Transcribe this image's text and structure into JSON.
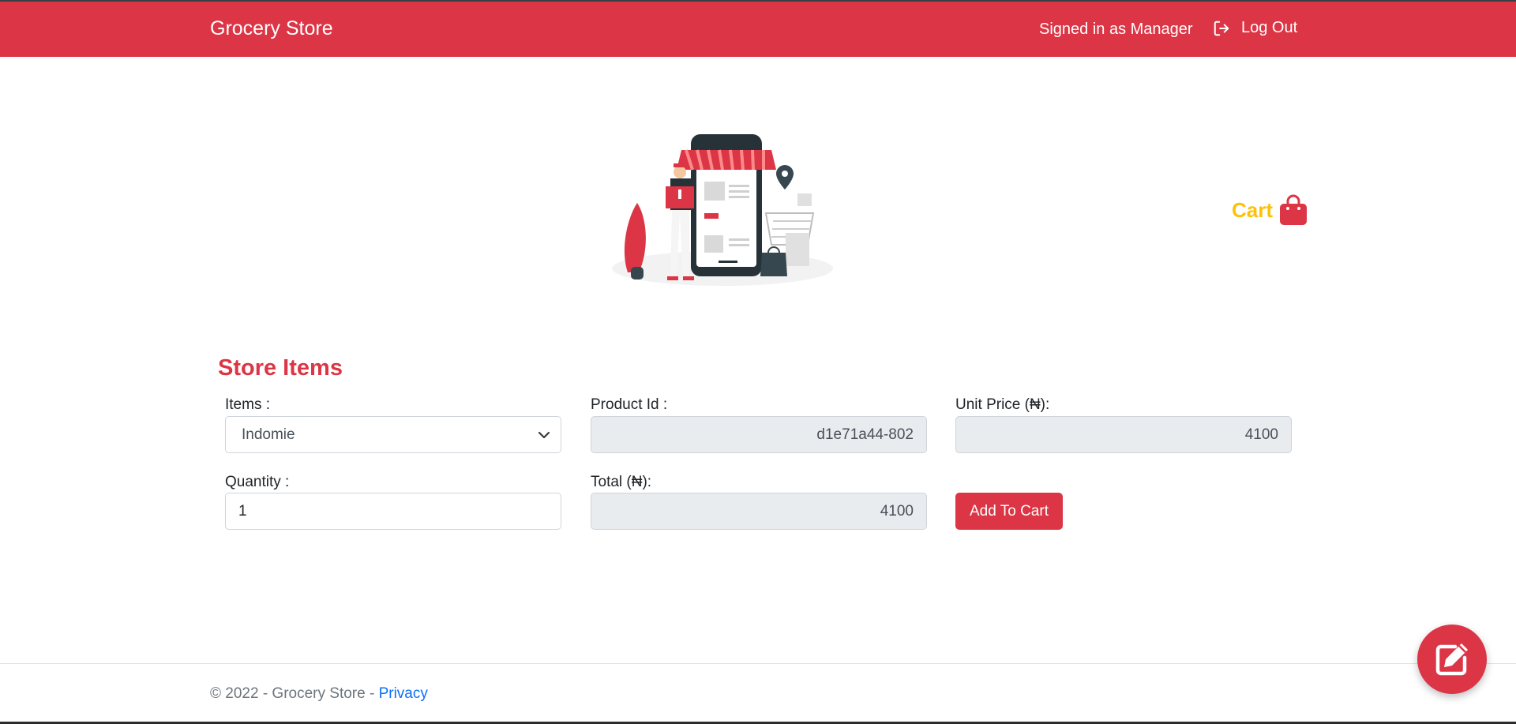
{
  "navbar": {
    "brand": "Grocery Store",
    "signed_in": "Signed in as Manager",
    "logout_label": "Log Out",
    "logout_icon": "sign-out-icon",
    "color": "#dc3545"
  },
  "cart": {
    "label": "Cart",
    "icon": "shopping-bag-icon",
    "color": "#ffc107"
  },
  "store": {
    "title": "Store Items",
    "items_label": "Items :",
    "items_selected": "Indomie",
    "product_id_label": "Product Id :",
    "product_id_value": "d1e71a44-802",
    "unit_price_label": "Unit Price (₦):",
    "unit_price_value": "4100",
    "quantity_label": "Quantity :",
    "quantity_value": "1",
    "total_label": "Total (₦):",
    "total_value": "4100",
    "add_button": "Add To Cart"
  },
  "footer": {
    "copyright": "© 2022 - Grocery Store - ",
    "privacy": "Privacy"
  },
  "fab": {
    "icon": "edit-icon"
  }
}
